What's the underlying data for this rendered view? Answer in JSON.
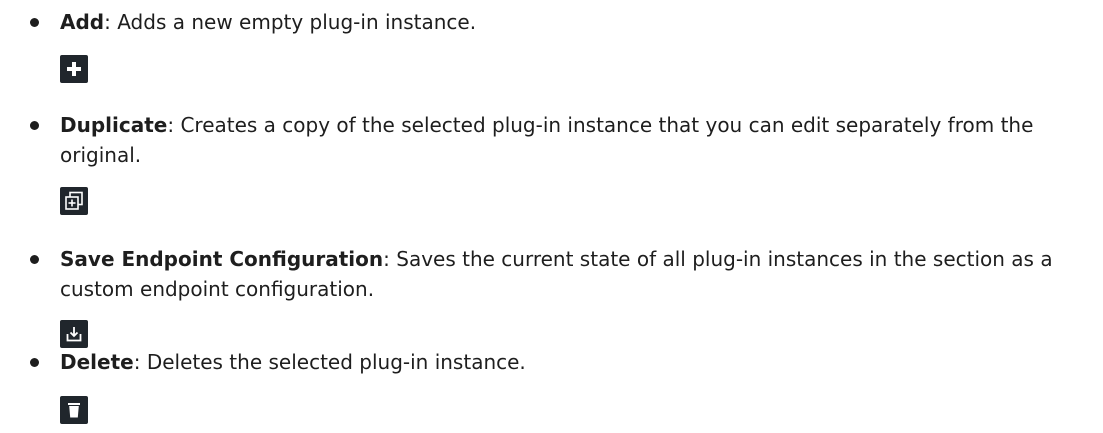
{
  "items": [
    {
      "term": "Add",
      "desc": ": Adds a new empty plug-in instance.",
      "icon": "plus-icon"
    },
    {
      "term": "Duplicate",
      "desc": ": Creates a copy of the selected plug-in instance that you can edit separately from the original.",
      "icon": "duplicate-icon"
    },
    {
      "term": "Save Endpoint Configuration",
      "desc": ": Saves the current state of all plug-in instances in the section as a custom endpoint configuration.",
      "icon": "save-download-icon"
    },
    {
      "term": "Delete",
      "desc": ": Deletes the selected plug-in instance.",
      "icon": "trash-icon"
    }
  ]
}
